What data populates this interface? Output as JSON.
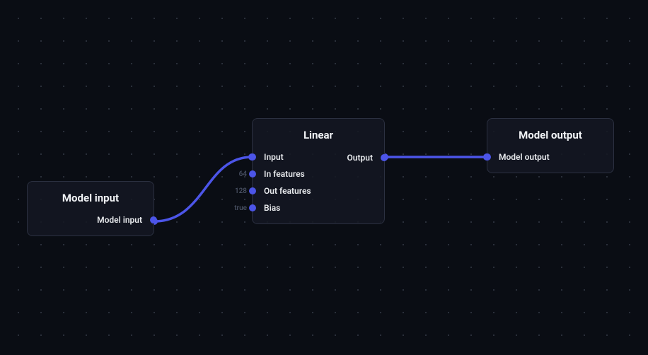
{
  "colors": {
    "accent": "#4c55e8",
    "node_bg": "rgba(20,24,34,0.85)",
    "node_border": "#2b3040"
  },
  "nodes": {
    "input": {
      "title": "Model input",
      "outputs": [
        {
          "label": "Model input"
        }
      ]
    },
    "linear": {
      "title": "Linear",
      "inputs": [
        {
          "label": "Input",
          "value": ""
        },
        {
          "label": "In features",
          "value": "64"
        },
        {
          "label": "Out features",
          "value": "128"
        },
        {
          "label": "Bias",
          "value": "true"
        }
      ],
      "outputs": [
        {
          "label": "Output"
        }
      ]
    },
    "output": {
      "title": "Model output",
      "inputs": [
        {
          "label": "Model output"
        }
      ]
    }
  }
}
